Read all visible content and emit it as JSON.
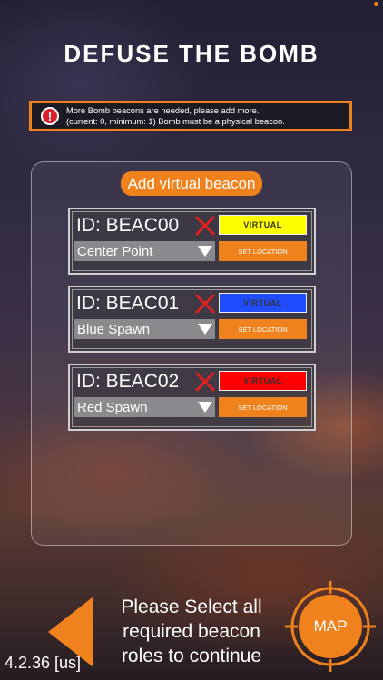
{
  "header": {
    "title": "DEFUSE THE BOMB"
  },
  "alert": {
    "text": "More Bomb beacons are needed, please add more.\n(current: 0, minimum: 1) Bomb must be a physical beacon.",
    "icon": "!",
    "border_color": "#f0821e"
  },
  "panel": {
    "add_button_label": "Add virtual beacon",
    "beacons": [
      {
        "id_label": "ID: BEAC00",
        "role_label": "VIRTUAL",
        "role_color": "#ffff00",
        "location": "Center Point",
        "set_location_label": "SET LOCATION"
      },
      {
        "id_label": "ID: BEAC01",
        "role_label": "VIRTUAL",
        "role_color": "#1f4dff",
        "location": "Blue Spawn",
        "set_location_label": "SET LOCATION"
      },
      {
        "id_label": "ID: BEAC02",
        "role_label": "VIRTUAL",
        "role_color": "#ff0000",
        "location": "Red Spawn",
        "set_location_label": "SET LOCATION"
      }
    ]
  },
  "footer": {
    "message": "Please Select all\nrequired beacon\nroles to continue",
    "version": "4.2.36 [us]",
    "map_label": "MAP"
  },
  "colors": {
    "accent": "#f0821e",
    "delete": "#e02020"
  }
}
